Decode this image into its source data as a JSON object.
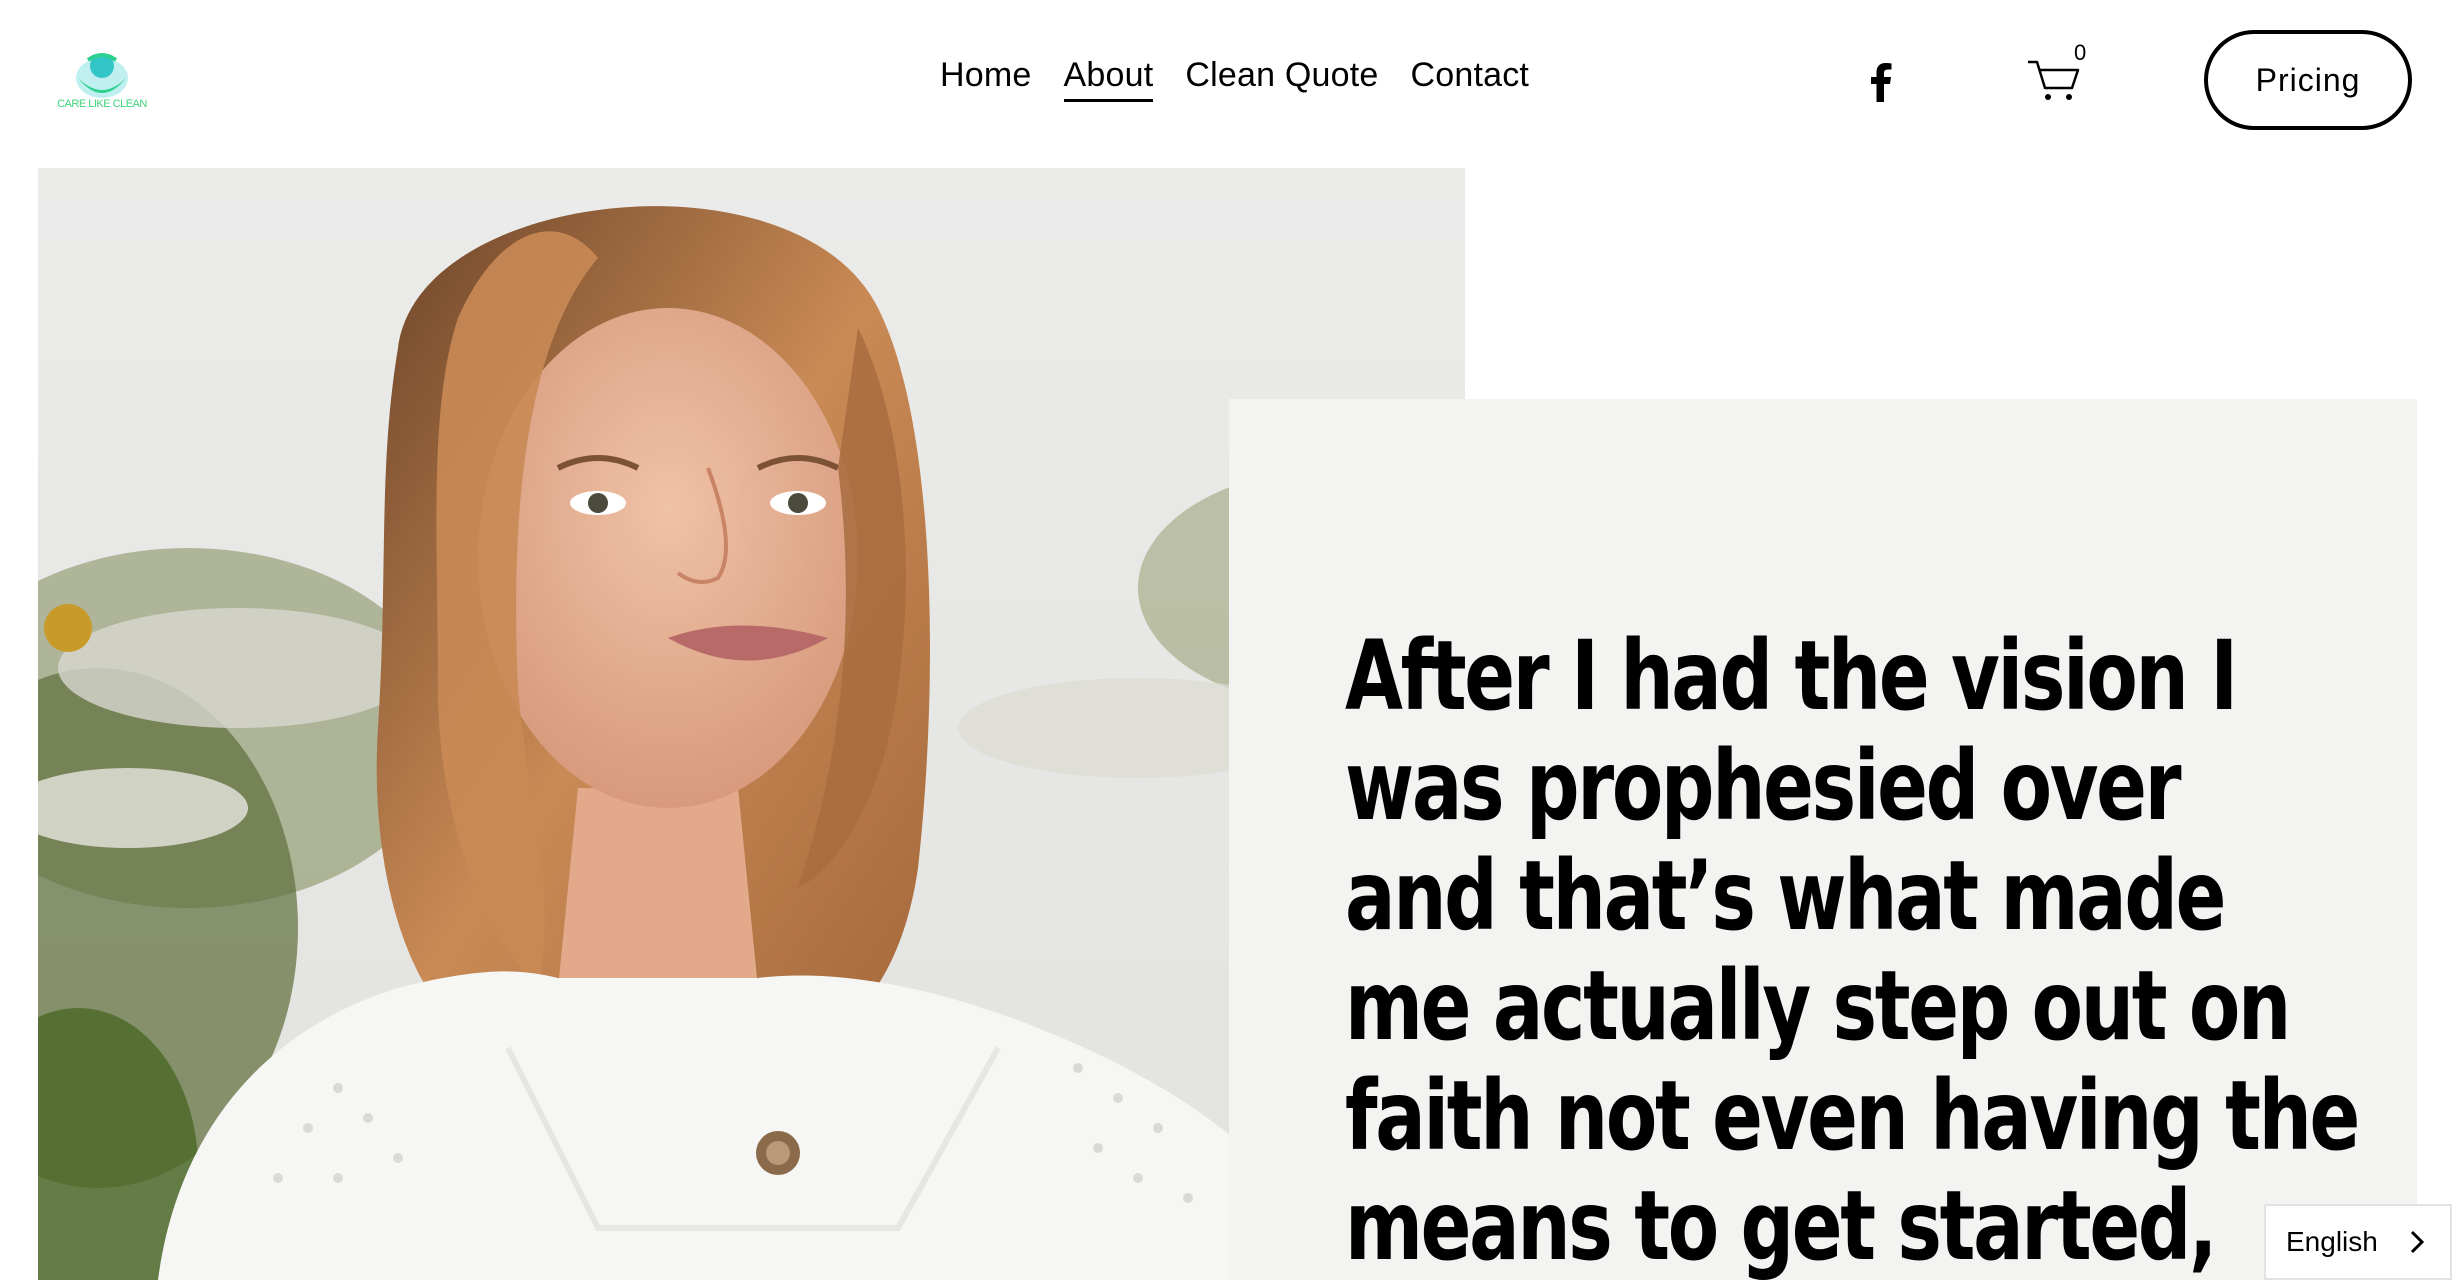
{
  "brand": {
    "logo_text": "CARE LIKE CLEAN",
    "logo_color": "#3ed37a",
    "logo_icon_color": "#33c6c9"
  },
  "nav": {
    "items": [
      {
        "label": "Home"
      },
      {
        "label": "About"
      },
      {
        "label": "Clean Quote"
      },
      {
        "label": "Contact"
      }
    ],
    "active": "About"
  },
  "header": {
    "social_icon": "facebook-icon",
    "cart_icon": "cart-icon",
    "cart_count": "0",
    "pricing_label": "Pricing"
  },
  "hero": {
    "photo_icon": "portrait-photo",
    "quote": "After I had the vision  I\nwas prophesied over\nand that’s what made\nme actually step out on\nfaith not even having the\nmeans to get started,"
  },
  "language": {
    "label": "English",
    "icon": "chevron-right-icon"
  }
}
